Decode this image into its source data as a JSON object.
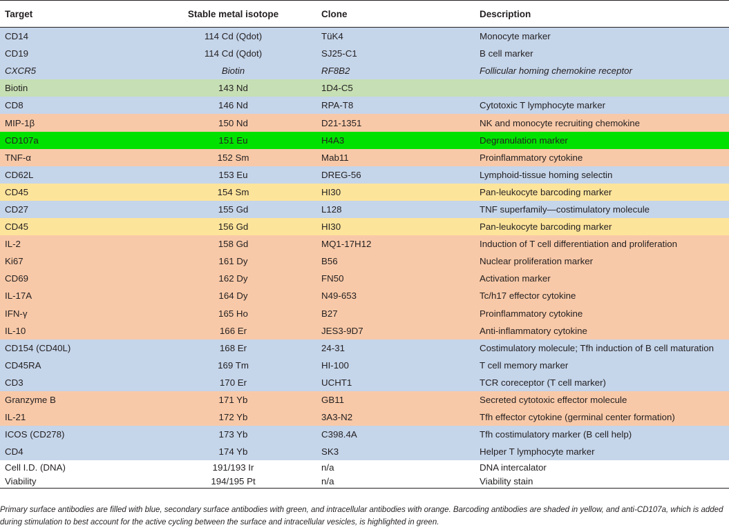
{
  "headers": {
    "target": "Target",
    "isotope": "Stable metal isotope",
    "clone": "Clone",
    "description": "Description"
  },
  "rows": [
    {
      "target": "CD14",
      "isotope": "114 Cd (Qdot)",
      "clone": "TüK4",
      "description": "Monocyte marker",
      "shade": "blue"
    },
    {
      "target": "CD19",
      "isotope": "114 Cd (Qdot)",
      "clone": "SJ25-C1",
      "description": "B cell marker",
      "shade": "blue"
    },
    {
      "target": "CXCR5",
      "isotope": "Biotin",
      "clone": "RF8B2",
      "description": "Follicular homing chemokine receptor",
      "shade": "blue",
      "italic": true
    },
    {
      "target": "Biotin",
      "isotope": "143 Nd",
      "clone": "1D4-C5",
      "description": "",
      "shade": "green"
    },
    {
      "target": "CD8",
      "isotope": "146 Nd",
      "clone": "RPA-T8",
      "description": "Cytotoxic T lymphocyte marker",
      "shade": "blue"
    },
    {
      "target": "MIP-1β",
      "isotope": "150 Nd",
      "clone": "D21-1351",
      "description": "NK and monocyte recruiting chemokine",
      "shade": "orange"
    },
    {
      "target": "CD107a",
      "isotope": "151 Eu",
      "clone": "H4A3",
      "description": "Degranulation marker",
      "shade": "brightgreen"
    },
    {
      "target": "TNF-α",
      "isotope": "152 Sm",
      "clone": "Mab11",
      "description": "Proinflammatory cytokine",
      "shade": "orange"
    },
    {
      "target": "CD62L",
      "isotope": "153 Eu",
      "clone": "DREG-56",
      "description": "Lymphoid-tissue homing selectin",
      "shade": "blue"
    },
    {
      "target": "CD45",
      "isotope": "154 Sm",
      "clone": "HI30",
      "description": "Pan-leukocyte barcoding marker",
      "shade": "yellow"
    },
    {
      "target": "CD27",
      "isotope": "155 Gd",
      "clone": "L128",
      "description": "TNF superfamily—costimulatory molecule",
      "shade": "blue"
    },
    {
      "target": "CD45",
      "isotope": "156 Gd",
      "clone": "HI30",
      "description": "Pan-leukocyte barcoding marker",
      "shade": "yellow"
    },
    {
      "target": "IL-2",
      "isotope": "158 Gd",
      "clone": "MQ1-17H12",
      "description": "Induction of T cell differentiation and proliferation",
      "shade": "orange"
    },
    {
      "target": "Ki67",
      "isotope": "161 Dy",
      "clone": "B56",
      "description": "Nuclear proliferation marker",
      "shade": "orange"
    },
    {
      "target": "CD69",
      "isotope": "162 Dy",
      "clone": "FN50",
      "description": "Activation marker",
      "shade": "orange"
    },
    {
      "target": "IL-17A",
      "isotope": "164 Dy",
      "clone": "N49-653",
      "description": "Tc/h17 effector cytokine",
      "shade": "orange"
    },
    {
      "target": "IFN-γ",
      "isotope": "165 Ho",
      "clone": "B27",
      "description": "Proinflammatory cytokine",
      "shade": "orange"
    },
    {
      "target": "IL-10",
      "isotope": "166 Er",
      "clone": "JES3-9D7",
      "description": "Anti-inflammatory cytokine",
      "shade": "orange"
    },
    {
      "target": "CD154 (CD40L)",
      "isotope": "168 Er",
      "clone": "24-31",
      "description": "Costimulatory molecule; Tfh induction of B cell maturation",
      "shade": "blue"
    },
    {
      "target": "CD45RA",
      "isotope": "169 Tm",
      "clone": "HI-100",
      "description": "T cell memory marker",
      "shade": "blue"
    },
    {
      "target": "CD3",
      "isotope": "170 Er",
      "clone": "UCHT1",
      "description": "TCR coreceptor (T cell marker)",
      "shade": "blue"
    },
    {
      "target": "Granzyme B",
      "isotope": "171 Yb",
      "clone": "GB11",
      "description": "Secreted cytotoxic effector molecule",
      "shade": "orange"
    },
    {
      "target": "IL-21",
      "isotope": "172 Yb",
      "clone": "3A3-N2",
      "description": "Tfh effector cytokine (germinal center formation)",
      "shade": "orange"
    },
    {
      "target": "ICOS (CD278)",
      "isotope": "173 Yb",
      "clone": "C398.4A",
      "description": "Tfh costimulatory marker (B cell help)",
      "shade": "blue"
    },
    {
      "target": "CD4",
      "isotope": "174 Yb",
      "clone": "SK3",
      "description": "Helper T lymphocyte marker",
      "shade": "blue"
    },
    {
      "target": "Cell I.D. (DNA)",
      "isotope": "191/193 Ir",
      "clone": "n/a",
      "description": "DNA intercalator",
      "shade": "white"
    },
    {
      "target": "Viability",
      "isotope": "194/195 Pt",
      "clone": "n/a",
      "description": "Viability stain",
      "shade": "white"
    }
  ],
  "shade_colors": {
    "blue": "#c5d5ea",
    "green": "#c6dfb4",
    "orange": "#f8c9a8",
    "yellow": "#fde49b",
    "brightgreen": "#00e100",
    "white": "#ffffff"
  },
  "footnote": "Primary surface antibodies are filled with blue, secondary surface antibodies with green, and intracellular antibodies with orange. Barcoding antibodies are shaded in yellow, and anti-CD107a, which is added during stimulation to best account for the active cycling between the surface and intracellular vesicles, is highlighted in green."
}
